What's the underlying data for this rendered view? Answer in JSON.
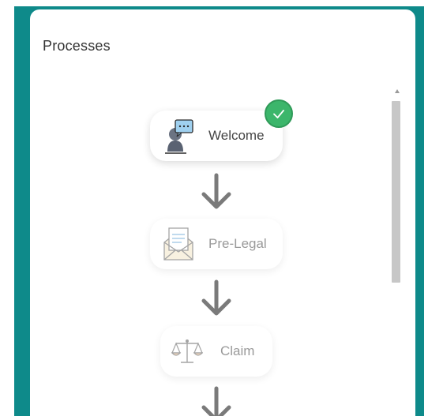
{
  "panel": {
    "title": "Processes"
  },
  "steps": [
    {
      "label": "Welcome",
      "status": "completed",
      "icon": "person-speech-bubble-icon"
    },
    {
      "label": "Pre-Legal",
      "status": "inactive",
      "icon": "envelope-letter-icon"
    },
    {
      "label": "Claim",
      "status": "inactive",
      "icon": "scales-icon"
    }
  ],
  "colors": {
    "frame": "#0e8a8a",
    "check": "#3cb66b",
    "arrow": "#7a7a7a"
  }
}
